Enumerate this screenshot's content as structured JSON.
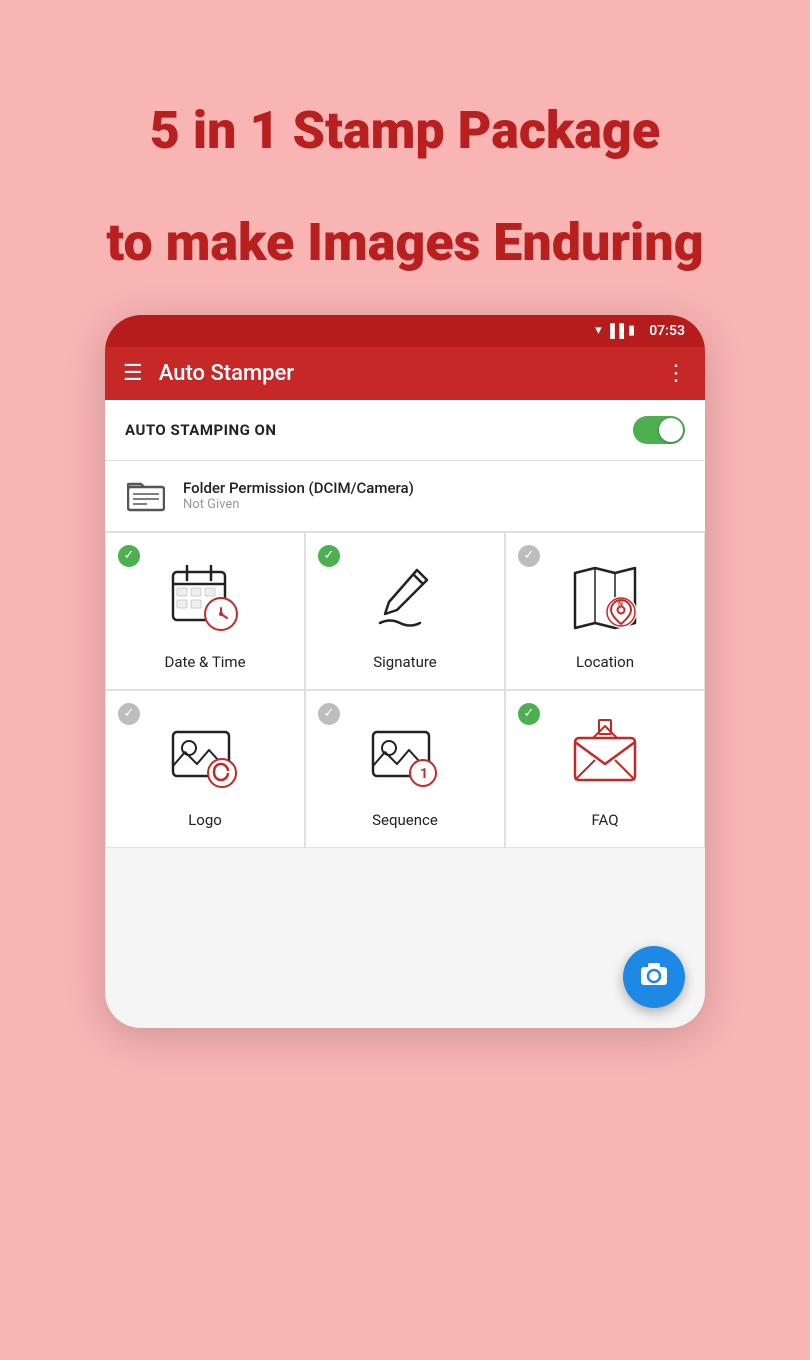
{
  "hero": {
    "line1": "5 in 1 Stamp Package",
    "line2": "to make Images Enduring"
  },
  "statusBar": {
    "time": "07:53"
  },
  "toolbar": {
    "title": "Auto Stamper",
    "menuIcon": "☰",
    "moreIcon": "⋮"
  },
  "autoStamp": {
    "label": "AUTO STAMPING ON",
    "toggleOn": true
  },
  "folderPermission": {
    "title": "Folder Permission (DCIM/Camera)",
    "subtitle": "Not Given"
  },
  "stampItems": [
    {
      "id": "datetime",
      "label": "Date & Time",
      "checkActive": true,
      "icon": "datetime"
    },
    {
      "id": "signature",
      "label": "Signature",
      "checkActive": true,
      "icon": "signature"
    },
    {
      "id": "location",
      "label": "Location",
      "checkActive": false,
      "icon": "location"
    },
    {
      "id": "logo",
      "label": "Logo",
      "checkActive": false,
      "icon": "logo"
    },
    {
      "id": "sequence",
      "label": "Sequence",
      "checkActive": false,
      "icon": "sequence"
    },
    {
      "id": "faq",
      "label": "FAQ",
      "checkActive": true,
      "icon": "faq"
    }
  ],
  "fab": {
    "icon": "📷"
  },
  "checks": {
    "active": "✓",
    "inactive": "✓"
  }
}
